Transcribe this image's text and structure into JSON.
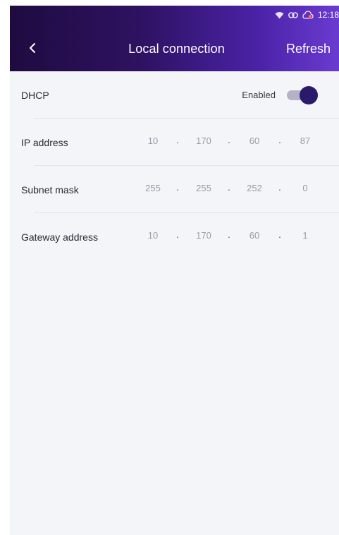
{
  "status_bar": {
    "icons": [
      "wifi-icon",
      "link-icon",
      "cloud-alert-icon"
    ],
    "time": "12:18"
  },
  "header": {
    "back_icon": "chevron-left-icon",
    "title": "Local connection",
    "refresh_label": "Refresh"
  },
  "dhcp": {
    "label": "DHCP",
    "status": "Enabled",
    "enabled": true
  },
  "network": {
    "ip_address": {
      "label": "IP address",
      "octets": [
        "10",
        "170",
        "60",
        "87"
      ]
    },
    "subnet_mask": {
      "label": "Subnet mask",
      "octets": [
        "255",
        "255",
        "252",
        "0"
      ]
    },
    "gateway": {
      "label": "Gateway address",
      "octets": [
        "10",
        "170",
        "60",
        "1"
      ]
    },
    "separator": "."
  },
  "colors": {
    "header_start": "#1f0b40",
    "header_end": "#6a3bd0",
    "toggle_knob": "#2b1a6b",
    "toggle_track": "#b6b2c6",
    "background": "#f4f5f9"
  }
}
